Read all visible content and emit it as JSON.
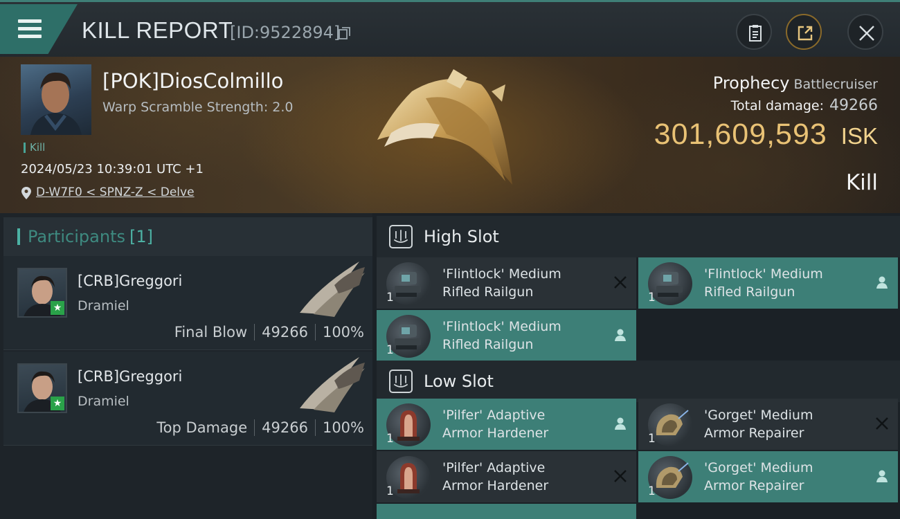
{
  "header": {
    "title": "KILL REPORT",
    "report_id": "[ID:9522894]"
  },
  "victim": {
    "name": "[POK]DiosColmillo",
    "warp_scramble": "Warp Scramble Strength: 2.0",
    "kill_tag": "Kill",
    "timestamp": "2024/05/23 10:39:01 UTC +1",
    "location": "D-W7F0 < SPNZ-Z < Delve"
  },
  "ship": {
    "name": "Prophecy",
    "class": "Battlecruiser",
    "total_damage_label": "Total damage:",
    "total_damage": "49266",
    "isk_value": "301,609,593",
    "isk_unit": "ISK",
    "result": "Kill"
  },
  "participants": {
    "title": "Participants",
    "count": "[1]",
    "items": [
      {
        "name": "[CRB]Greggori",
        "ship": "Dramiel",
        "role": "Final Blow",
        "damage": "49266",
        "percent": "100%"
      },
      {
        "name": "[CRB]Greggori",
        "ship": "Dramiel",
        "role": "Top Damage",
        "damage": "49266",
        "percent": "100%"
      }
    ]
  },
  "slots": {
    "high_label": "High Slot",
    "low_label": "Low Slot",
    "high": [
      {
        "line1": "'Flintlock' Medium",
        "line2": "Rifled Railgun",
        "qty": "1",
        "status": "destroyed"
      },
      {
        "line1": "'Flintlock' Medium",
        "line2": "Rifled Railgun",
        "qty": "1",
        "status": "dropped"
      },
      {
        "line1": "'Flintlock' Medium",
        "line2": "Rifled Railgun",
        "qty": "1",
        "status": "dropped"
      }
    ],
    "low": [
      {
        "line1": "'Pilfer' Adaptive",
        "line2": "Armor Hardener",
        "qty": "1",
        "status": "dropped"
      },
      {
        "line1": "'Gorget' Medium",
        "line2": "Armor Repairer",
        "qty": "1",
        "status": "destroyed"
      },
      {
        "line1": "'Pilfer' Adaptive",
        "line2": "Armor Hardener",
        "qty": "1",
        "status": "destroyed"
      },
      {
        "line1": "'Gorget' Medium",
        "line2": "Armor Repairer",
        "qty": "1",
        "status": "dropped"
      }
    ]
  },
  "colors": {
    "accent": "#3d7f77",
    "isk": "#e9c275",
    "star": "#2aa249"
  }
}
